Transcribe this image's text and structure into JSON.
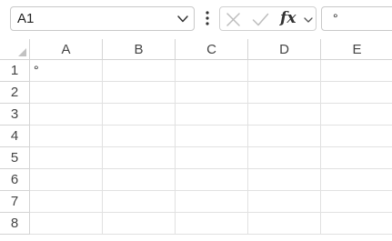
{
  "namebox": {
    "value": "A1",
    "chevron_icon": "chevron-down-icon"
  },
  "formula_bar": {
    "more_icon": "vertical-ellipsis-icon",
    "cancel_icon": "close-icon",
    "enter_icon": "checkmark-icon",
    "fx_label": "fx",
    "fx_chevron_icon": "chevron-down-icon",
    "value": "°"
  },
  "grid": {
    "columns": [
      "A",
      "B",
      "C",
      "D",
      "E"
    ],
    "rows": [
      "1",
      "2",
      "3",
      "4",
      "5",
      "6",
      "7",
      "8"
    ],
    "cells": {
      "A1": "°"
    }
  }
}
